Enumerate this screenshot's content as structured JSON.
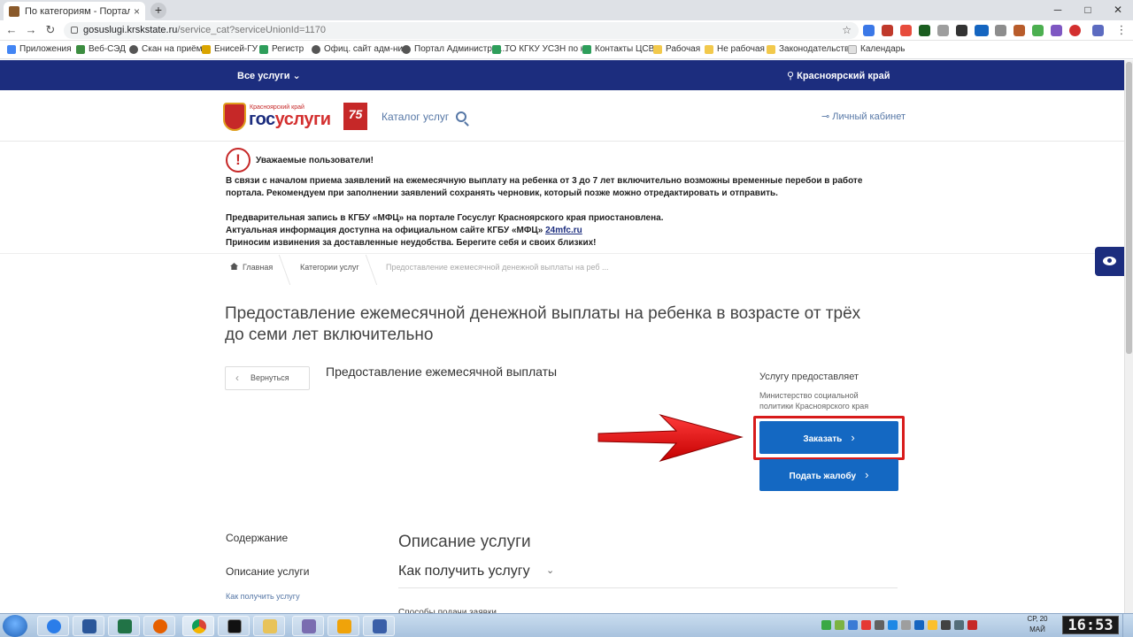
{
  "browser": {
    "tab_title": "По категориям - Портал госуда",
    "tab_close": "×",
    "new_tab": "+",
    "url_host": "gosuslugi.krskstate.ru",
    "url_path": "/service_cat?serviceUnionId=1170",
    "window_controls": [
      "─",
      "□",
      "✕"
    ],
    "bookmarks": [
      {
        "label": "Приложения",
        "color": "#4285f4"
      },
      {
        "label": "Веб-СЭД",
        "color": "#3c8d40"
      },
      {
        "label": "Скан на приёме",
        "color": "#555555"
      },
      {
        "label": "Енисей-ГУ",
        "color": "#d9a400"
      },
      {
        "label": "Регистр",
        "color": "#2e9e5b"
      },
      {
        "label": "Офиц. сайт адм-ни...",
        "color": "#555555"
      },
      {
        "label": "Портал Администрат...",
        "color": "#555555"
      },
      {
        "label": "ТО КГКУ УСЗН по к...",
        "color": "#2e9e5b"
      },
      {
        "label": "Контакты ЦСВ",
        "color": "#2e9e5b"
      },
      {
        "label": "Рабочая",
        "color": "#f2c94c"
      },
      {
        "label": "Не рабочая",
        "color": "#f2c94c"
      },
      {
        "label": "Законодательство",
        "color": "#f2c94c"
      },
      {
        "label": "Календарь",
        "color": "#e0e0e0"
      }
    ]
  },
  "site": {
    "all_services": "Все услуги ⌄",
    "region": "Красноярский край",
    "logo_region": "Красноярский край",
    "logo_gos": "гос",
    "logo_uslugi": "услуги",
    "logo_75": "75",
    "catalog": "Каталог услуг",
    "cabinet": "Личный кабинет"
  },
  "notice": {
    "icon": "!",
    "title": "Уважаемые пользователи!",
    "line1": "В связи с началом приема заявлений на ежемесячную выплату на ребенка от 3 до 7 лет включительно возможны временные перебои в работе",
    "line2": "портала. Рекомендуем при заполнении заявлений сохранять черновик, который позже можно отредактировать и отправить.",
    "line3": "Предварительная запись в КГБУ «МФЦ» на портале Госуслуг Красноярского края приостановлена.",
    "line4_prefix": "Актуальная информация доступна на официальном сайте КГБУ «МФЦ» ",
    "line4_link": "24mfc.ru",
    "line5": "Приносим извинения за доставленные неудобства. Берегите себя и своих близких!"
  },
  "breadcrumb": {
    "home": "Главная",
    "categories": "Категории услуг",
    "current": "Предоставление ежемесячной денежной выплаты на реб ..."
  },
  "service": {
    "title": "Предоставление ежемесячной денежной выплаты на ребенка в возрасте от трёх до семи лет включительно",
    "back": "Вернуться",
    "subtitle": "Предоставление ежемесячной выплаты",
    "provider_label": "Услугу предоставляет",
    "provider_name": "Министерство социальной политики Красноярского края",
    "order_button": "Заказать",
    "complaint_button": "Подать жалобу"
  },
  "content": {
    "toc_title": "Содержание",
    "toc_item1": "Описание услуги",
    "toc_item2": "Как получить услугу",
    "desc_title": "Описание услуги",
    "how_title": "Как получить услугу",
    "cut_text": "Способы подачи заявки"
  },
  "taskbar": {
    "lang_line1": "СР, 20",
    "lang_line2": "МАЙ",
    "clock": "16:53"
  },
  "colors": {
    "site_nav": "#1c2d7e",
    "primary_button": "#1468c2",
    "highlight_red": "#d81b1b"
  }
}
